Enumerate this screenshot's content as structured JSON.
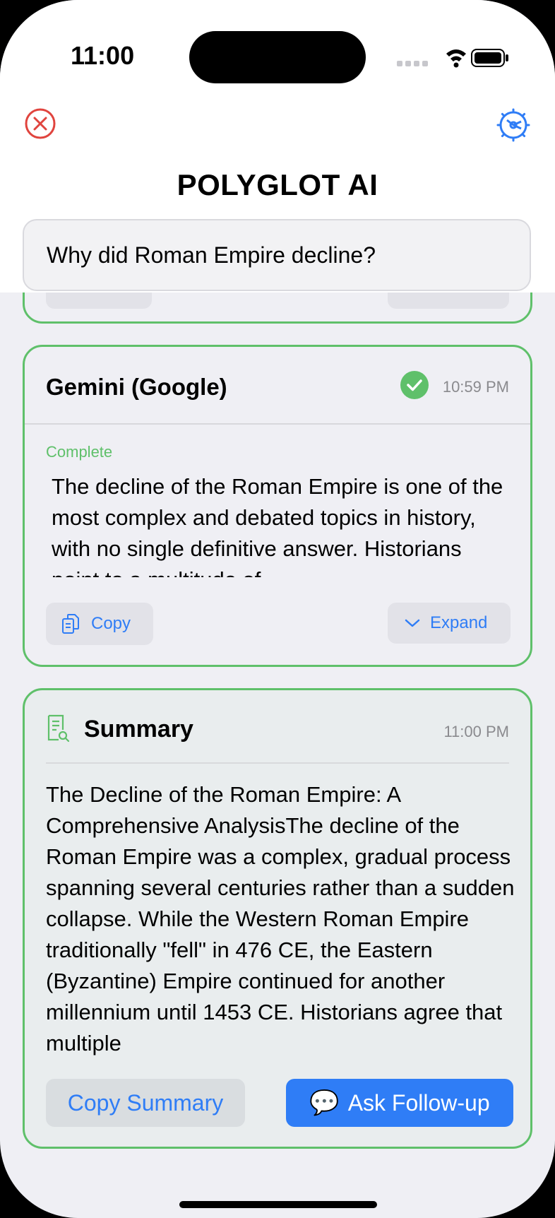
{
  "status_bar": {
    "time": "11:00"
  },
  "header": {
    "close_icon": "close-circle-icon",
    "settings_icon": "gear-icon",
    "title": "POLYGLOT AI"
  },
  "query": {
    "text": "Why did Roman Empire decline?"
  },
  "gemini_card": {
    "name": "Gemini (Google)",
    "status_icon": "checkmark-circle-icon",
    "time": "10:59 PM",
    "status": "Complete",
    "response": "The decline of the Roman Empire is one of the most complex and debated topics in history, with no single definitive answer. Historians point to a multitude of",
    "copy_label": "Copy",
    "expand_label": "Expand"
  },
  "summary_card": {
    "title": "Summary",
    "time": "11:00 PM",
    "text": "The Decline of the Roman Empire: A Comprehensive AnalysisThe decline of the Roman Empire was a complex, gradual process spanning several centuries rather than a sudden collapse. While the Western Roman Empire traditionally \"fell\" in 476 CE, the Eastern (Byzantine) Empire continued for another millennium until 1453 CE. Historians agree that multiple",
    "copy_summary_label": "Copy Summary",
    "ask_followup_label": "Ask Follow-up",
    "ask_followup_icon": "💬"
  },
  "colors": {
    "accent": "#2f7df6",
    "success": "#5fc06a",
    "close": "#e0443e"
  }
}
